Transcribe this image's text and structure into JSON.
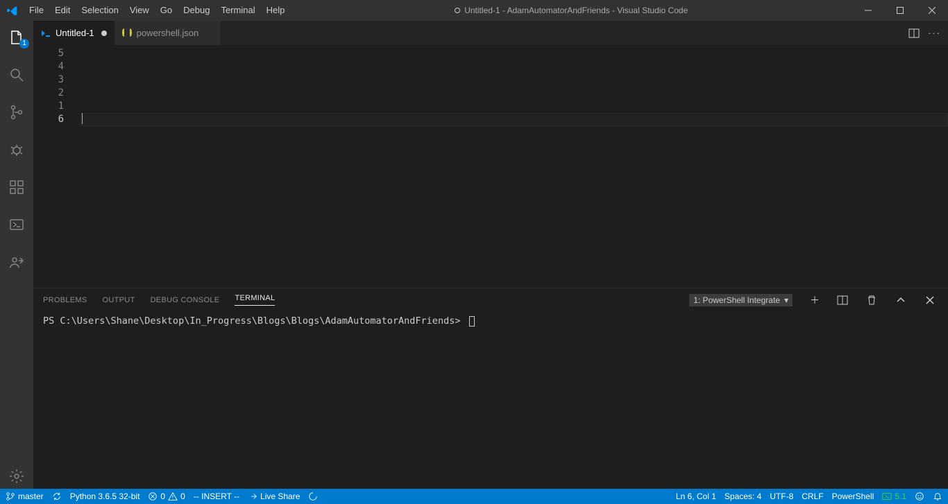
{
  "titlebar": {
    "menu": [
      "File",
      "Edit",
      "Selection",
      "View",
      "Go",
      "Debug",
      "Terminal",
      "Help"
    ],
    "title": "Untitled-1 - AdamAutomatorAndFriends - Visual Studio Code",
    "dirty": true
  },
  "activitybar": {
    "explorer_badge": "1"
  },
  "tabs": [
    {
      "label": "Untitled-1",
      "icon": "powershell",
      "active": true,
      "dirty": true
    },
    {
      "label": "powershell.json",
      "icon": "json",
      "active": false,
      "dirty": false
    }
  ],
  "editor": {
    "line_numbers": [
      "5",
      "4",
      "3",
      "2",
      "1",
      "6"
    ],
    "current_line_index": 5
  },
  "panel": {
    "tabs": [
      "PROBLEMS",
      "OUTPUT",
      "DEBUG CONSOLE",
      "TERMINAL"
    ],
    "active_tab_index": 3,
    "selector": "1: PowerShell Integrate",
    "prompt": "PS C:\\Users\\Shane\\Desktop\\In_Progress\\Blogs\\Blogs\\AdamAutomatorAndFriends>"
  },
  "statusbar": {
    "branch": "master",
    "python": "Python 3.6.5 32-bit",
    "errors": "0",
    "warnings": "0",
    "mode": "-- INSERT --",
    "liveshare": "Live Share",
    "position": "Ln 6, Col 1",
    "spaces": "Spaces: 4",
    "encoding": "UTF-8",
    "eol": "CRLF",
    "language": "PowerShell",
    "ps_version": "5.1"
  }
}
